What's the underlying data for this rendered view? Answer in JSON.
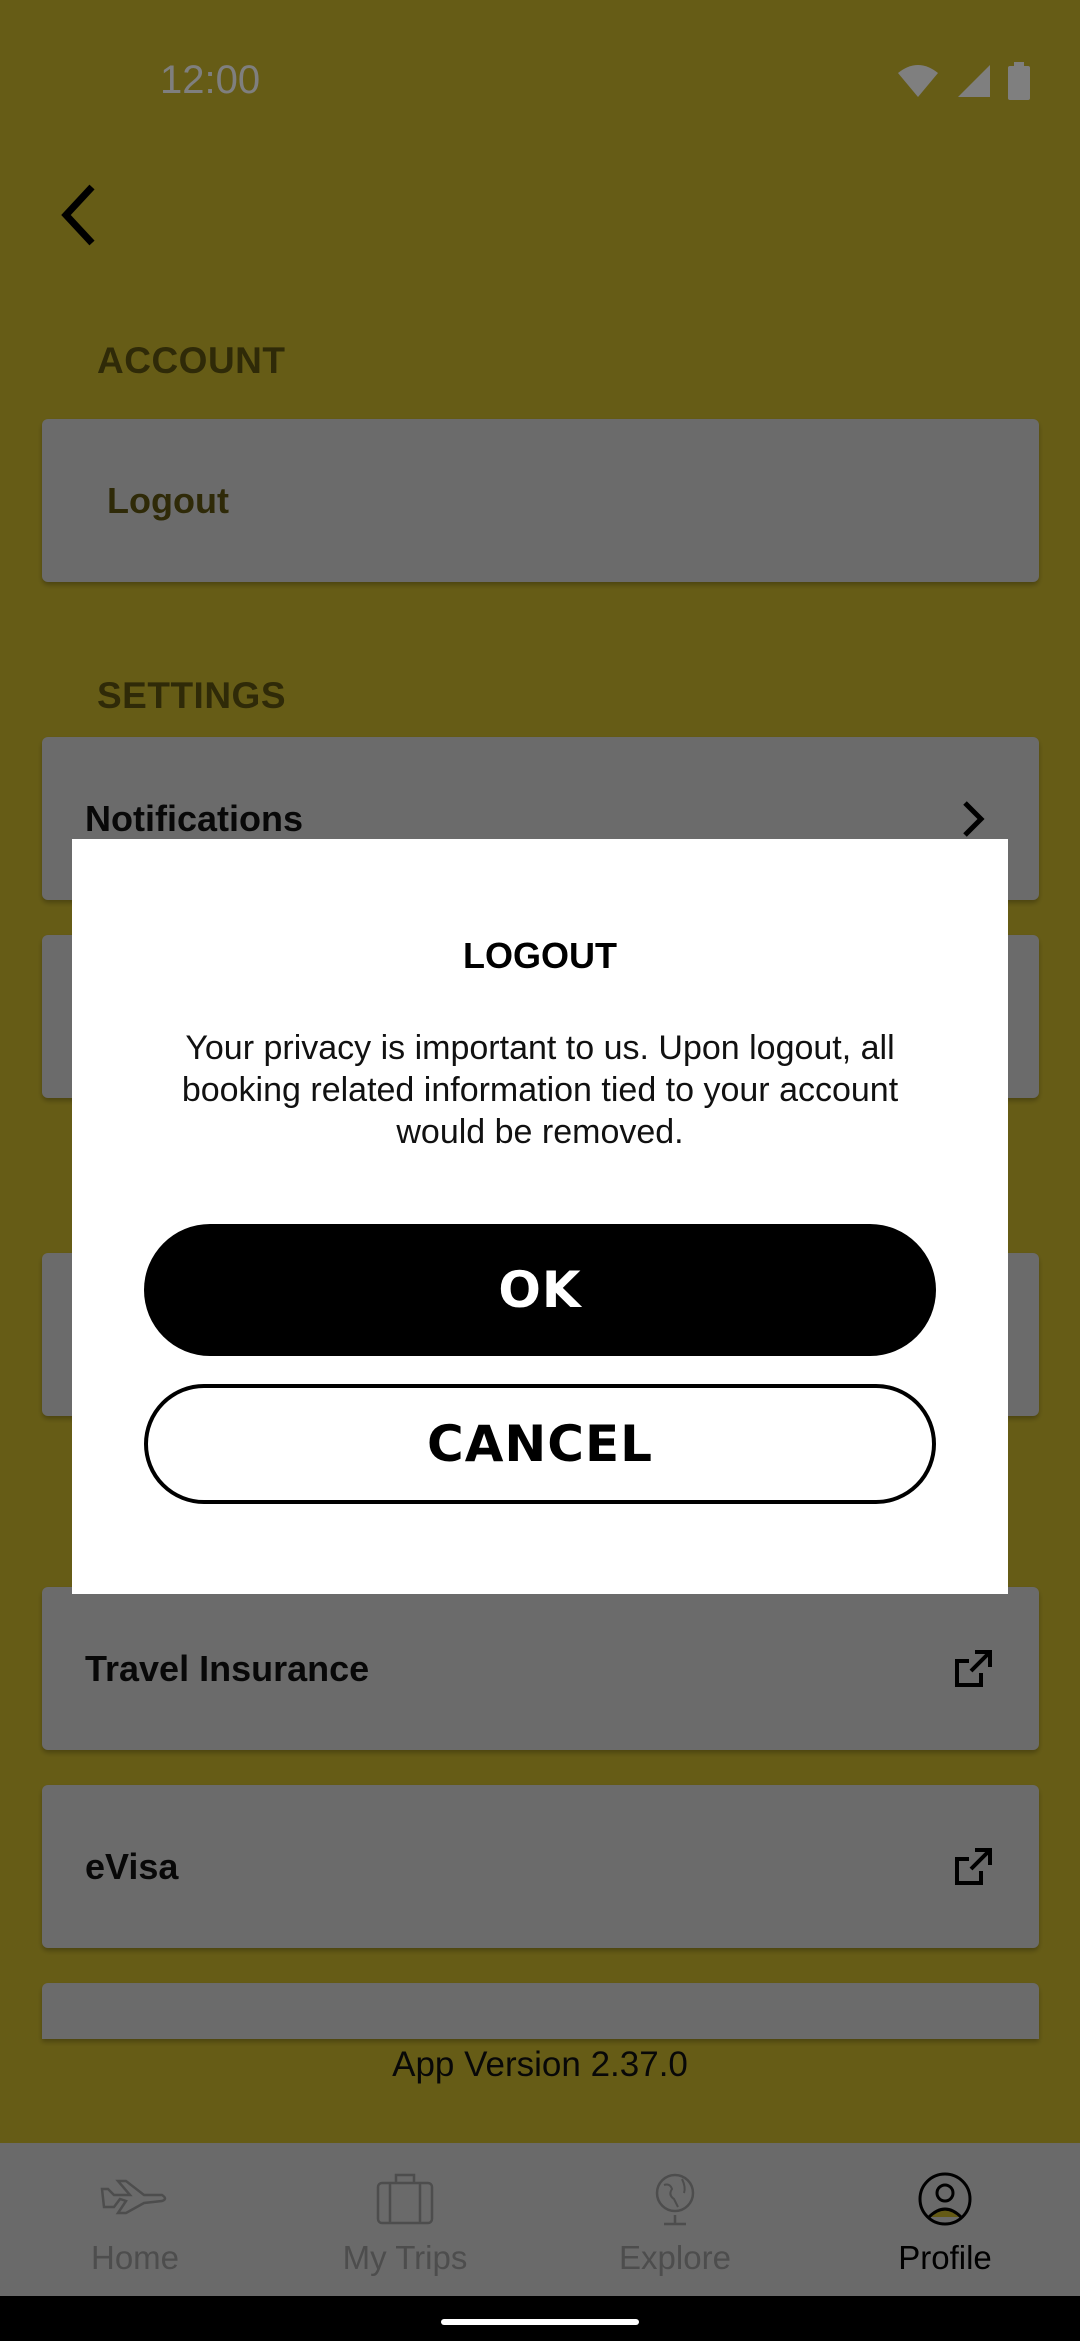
{
  "status_bar": {
    "time": "12:00"
  },
  "sections": {
    "account_label": "ACCOUNT",
    "settings_label": "SETTINGS"
  },
  "cards": {
    "logout": "Logout",
    "notifications": "Notifications",
    "travel_insurance": "Travel Insurance",
    "evisa": "eVisa"
  },
  "app_version": "App Version 2.37.0",
  "bottom_nav": {
    "items": [
      {
        "label": "Home",
        "icon": "airplane-icon"
      },
      {
        "label": "My Trips",
        "icon": "suitcase-icon"
      },
      {
        "label": "Explore",
        "icon": "globe-icon"
      },
      {
        "label": "Profile",
        "icon": "profile-icon"
      }
    ],
    "active": "Profile"
  },
  "dialog": {
    "title": "LOGOUT",
    "message": "Your privacy is important to us. Upon logout, all booking related information tied to your account would be removed.",
    "ok_label": "OK",
    "cancel_label": "CANCEL"
  },
  "colors": {
    "background": "#cdb92d",
    "card": "#d6d6d6",
    "scrim": "rgba(0,0,0,0.5)",
    "primary_button": "#000000"
  }
}
